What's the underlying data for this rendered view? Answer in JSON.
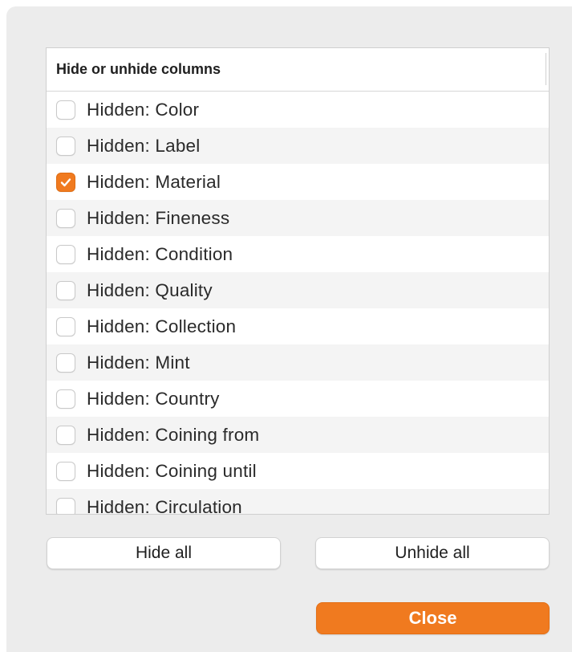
{
  "table": {
    "header": "Hide or unhide columns",
    "rows": [
      {
        "label": "Hidden: Color",
        "checked": false
      },
      {
        "label": "Hidden: Label",
        "checked": false
      },
      {
        "label": "Hidden: Material",
        "checked": true
      },
      {
        "label": "Hidden: Fineness",
        "checked": false
      },
      {
        "label": "Hidden: Condition",
        "checked": false
      },
      {
        "label": "Hidden: Quality",
        "checked": false
      },
      {
        "label": "Hidden: Collection",
        "checked": false
      },
      {
        "label": "Hidden: Mint",
        "checked": false
      },
      {
        "label": "Hidden: Country",
        "checked": false
      },
      {
        "label": "Hidden: Coining from",
        "checked": false
      },
      {
        "label": "Hidden: Coining until",
        "checked": false
      },
      {
        "label": "Hidden: Circulation",
        "checked": false
      }
    ]
  },
  "buttons": {
    "hide_all": "Hide all",
    "unhide_all": "Unhide all",
    "close": "Close"
  },
  "colors": {
    "accent": "#f07a1f",
    "dialog_bg": "#ececec"
  },
  "icons": {
    "check": "checkmark-icon"
  }
}
